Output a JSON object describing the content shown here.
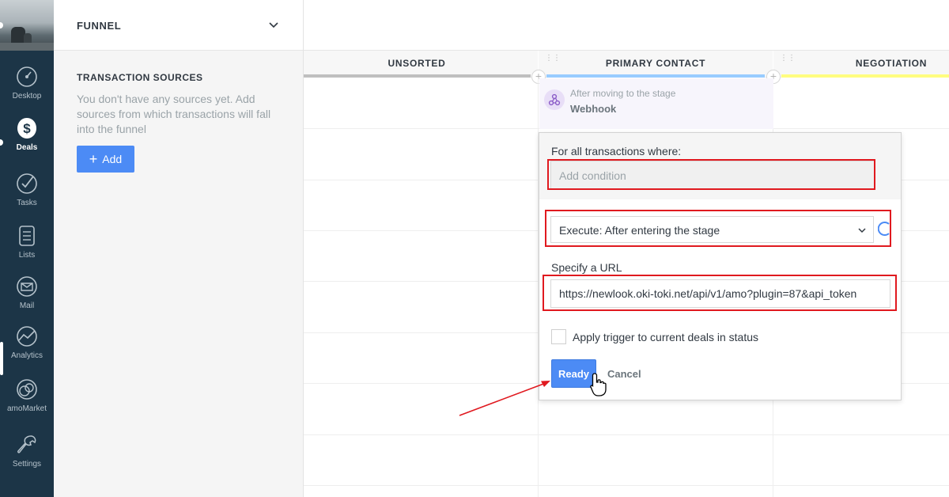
{
  "nav": {
    "items": [
      {
        "label": "Desktop",
        "icon": "speedometer-icon"
      },
      {
        "label": "Deals",
        "icon": "dollar-icon"
      },
      {
        "label": "Tasks",
        "icon": "checkmark-icon"
      },
      {
        "label": "Lists",
        "icon": "list-icon"
      },
      {
        "label": "Mail",
        "icon": "mail-icon"
      },
      {
        "label": "Analytics",
        "icon": "analytics-icon"
      },
      {
        "label": "amoMarket",
        "icon": "market-icon"
      },
      {
        "label": "Settings",
        "icon": "wrench-icon"
      }
    ],
    "active": "Deals"
  },
  "panel": {
    "title": "FUNNEL",
    "sources_title": "TRANSACTION SOURCES",
    "sources_text": "You don't have any sources yet. Add sources from which transactions will fall into the funnel",
    "add_label": "Add"
  },
  "board": {
    "columns": [
      {
        "label": "UNSORTED",
        "color": "#bfbfbf"
      },
      {
        "label": "PRIMARY CONTACT",
        "color": "#99ccff"
      },
      {
        "label": "NEGOTIATION",
        "color": "#fffd7f"
      }
    ],
    "webhook_card": {
      "line1": "After moving to the stage",
      "line2": "Webhook"
    }
  },
  "popup": {
    "condition_label": "For all transactions where:",
    "condition_placeholder": "Add condition",
    "execute_value": "Execute:  After entering the stage",
    "url_label": "Specify a URL",
    "url_value": "https://newlook.oki-toki.net/api/v1/amo?plugin=87&api_token",
    "apply_label": "Apply trigger to current deals in status",
    "apply_checked": false,
    "ready_label": "Ready",
    "cancel_label": "Cancel"
  },
  "colors": {
    "nav_bg": "#1c3547",
    "accent": "#4c8bf5",
    "annotation_red": "#e0191f"
  }
}
